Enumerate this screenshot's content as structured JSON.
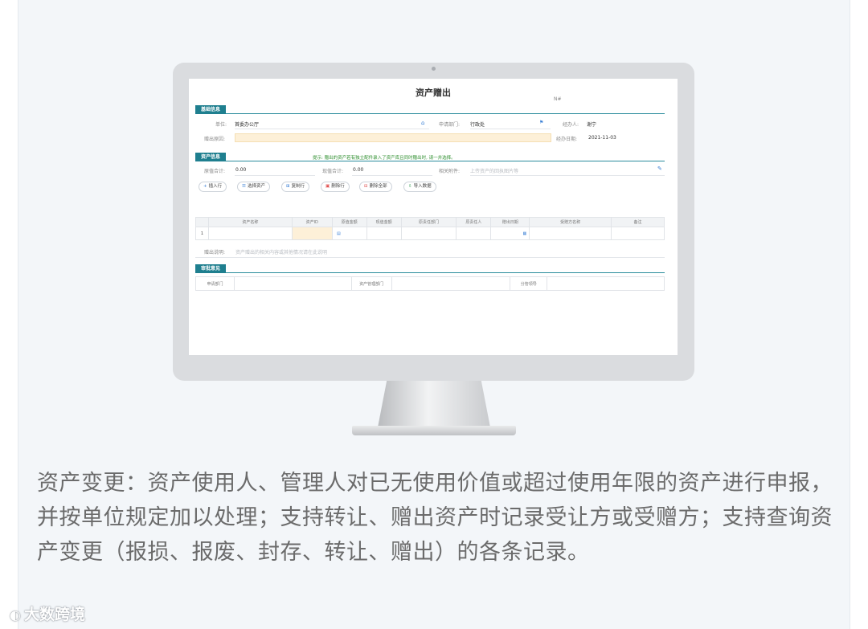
{
  "form": {
    "title": "资产赠出",
    "no_label": "N#",
    "basic_section": "基础信息",
    "unit_label": "单位:",
    "unit_value": "首委办公厅",
    "dept_label": "申请部门:",
    "dept_value": "行政处",
    "handler_label": "经办人:",
    "handler_value": "谢宁",
    "reason_label": "赠出原因:",
    "date_label": "经办日期:",
    "date_value": "2021-11-03",
    "asset_section": "资产信息",
    "tip": "提示: 赠出的资产若有独立配件录入了资产库且同时赠出时, 请一并选择。",
    "orig_total_label": "原值合计:",
    "orig_total_value": "0.00",
    "cur_total_label": "现值合计:",
    "cur_total_value": "0.00",
    "attach_label": "相关附件:",
    "attach_placeholder": "上传资产的回执图片等",
    "buttons": {
      "insert": "插入行",
      "select": "选择资产",
      "copy": "复制行",
      "delete": "删除行",
      "delete_all": "删除全部",
      "import": "导入数据"
    },
    "columns": [
      "资产名称",
      "资产ID",
      "原值金额",
      "现值金额",
      "原责任部门",
      "原责任人",
      "赠出日期",
      "受赠方名称",
      "备注"
    ],
    "row_number": "1",
    "remark_label": "赠出说明:",
    "remark_placeholder": "资产赠出的相关内容或其他情况请在此说明",
    "approval_section": "审批意见",
    "approval_cols": [
      "申请部门",
      "资产管理部门",
      "分管领导"
    ]
  },
  "description": "资产变更：资产使用人、管理人对已无使用价值或超过使用年限的资产进行申报，并按单位规定加以处理；支持转让、赠出资产时记录受让方或受赠方；支持查询资产变更（报损、报废、封存、转让、赠出）的各条记录。",
  "watermark": "大数跨境",
  "icons": [
    "home-icon",
    "flag-icon",
    "paperclip-icon",
    "plus-icon",
    "calendar-icon",
    "copy-icon"
  ]
}
